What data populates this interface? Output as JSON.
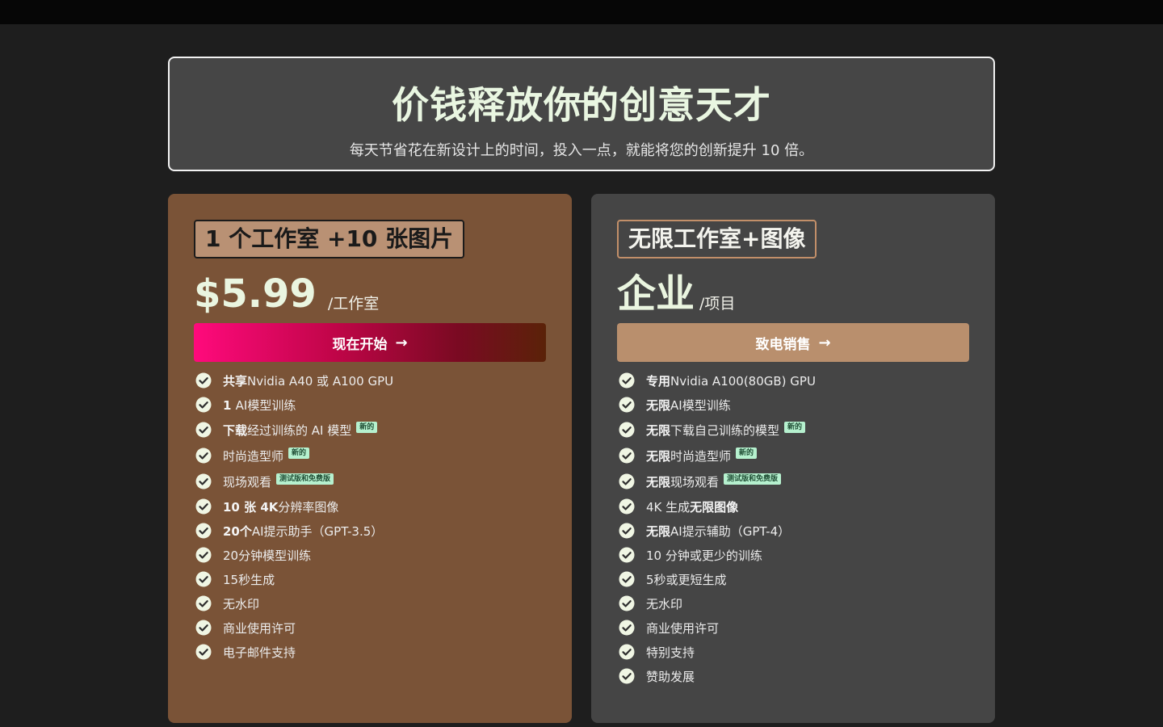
{
  "hero": {
    "title": "价钱释放你的创意天才",
    "subtitle": "每天节省花在新设计上的时间，投入一点，就能将您的创新提升 10 倍。"
  },
  "plans": [
    {
      "name": "1 个工作室 +10 张图片",
      "price": "$5.99",
      "per": "/工作室",
      "cta_label": "现在开始",
      "features": [
        {
          "bold": "共享",
          "text": "Nvidia A40 或 A100 GPU",
          "badge": ""
        },
        {
          "bold": "1 ",
          "text": "AI模型训练",
          "badge": ""
        },
        {
          "bold": "下载",
          "text": "经过训练的 AI 模型",
          "badge": "新的"
        },
        {
          "bold": "",
          "text": "时尚造型师",
          "badge": "新的"
        },
        {
          "bold": "",
          "text": "现场观看",
          "badge": "测试版和免费版"
        },
        {
          "bold": "10 张 4K",
          "text": "分辨率图像",
          "badge": ""
        },
        {
          "bold": "20个",
          "text": "AI提示助手（GPT-3.5）",
          "badge": ""
        },
        {
          "bold": "",
          "text": "20分钟模型训练",
          "badge": ""
        },
        {
          "bold": "",
          "text": "15秒生成",
          "badge": ""
        },
        {
          "bold": "",
          "text": "无水印",
          "badge": ""
        },
        {
          "bold": "",
          "text": "商业使用许可",
          "badge": ""
        },
        {
          "bold": "",
          "text": "电子邮件支持",
          "badge": ""
        }
      ]
    },
    {
      "name": "无限工作室+图像",
      "price": "企业",
      "per": "/项目",
      "cta_label": "致电销售",
      "features": [
        {
          "bold": "专用",
          "text": "Nvidia A100(80GB) GPU",
          "badge": ""
        },
        {
          "bold": "无限",
          "text": "AI模型训练",
          "badge": ""
        },
        {
          "bold": "无限",
          "text": "下载自己训练的模型",
          "badge": "新的"
        },
        {
          "bold": "无限",
          "text": "时尚造型师",
          "badge": "新的"
        },
        {
          "bold": "无限",
          "text": "现场观看",
          "badge": "测试版和免费版"
        },
        {
          "bold": "",
          "text": "4K 生成",
          "badge": "",
          "tail_bold": "无限图像"
        },
        {
          "bold": "无限",
          "text": "AI提示辅助（GPT-4）",
          "badge": ""
        },
        {
          "bold": "",
          "text": "10 分钟或更少的训练",
          "badge": ""
        },
        {
          "bold": "",
          "text": "5秒或更短生成",
          "badge": ""
        },
        {
          "bold": "",
          "text": "无水印",
          "badge": ""
        },
        {
          "bold": "",
          "text": "商业使用许可",
          "badge": ""
        },
        {
          "bold": "",
          "text": "特别支持",
          "badge": ""
        },
        {
          "bold": "",
          "text": "赞助发展",
          "badge": ""
        }
      ]
    }
  ],
  "icons": {
    "check": "check-circle-icon",
    "arrow": "arrow-right-icon"
  },
  "colors": {
    "background": "#1e1e1e",
    "left_card": "#7a5337",
    "right_card": "#454545",
    "accent_pink": "#ff0a7c",
    "badge": "#b6f1cf"
  }
}
